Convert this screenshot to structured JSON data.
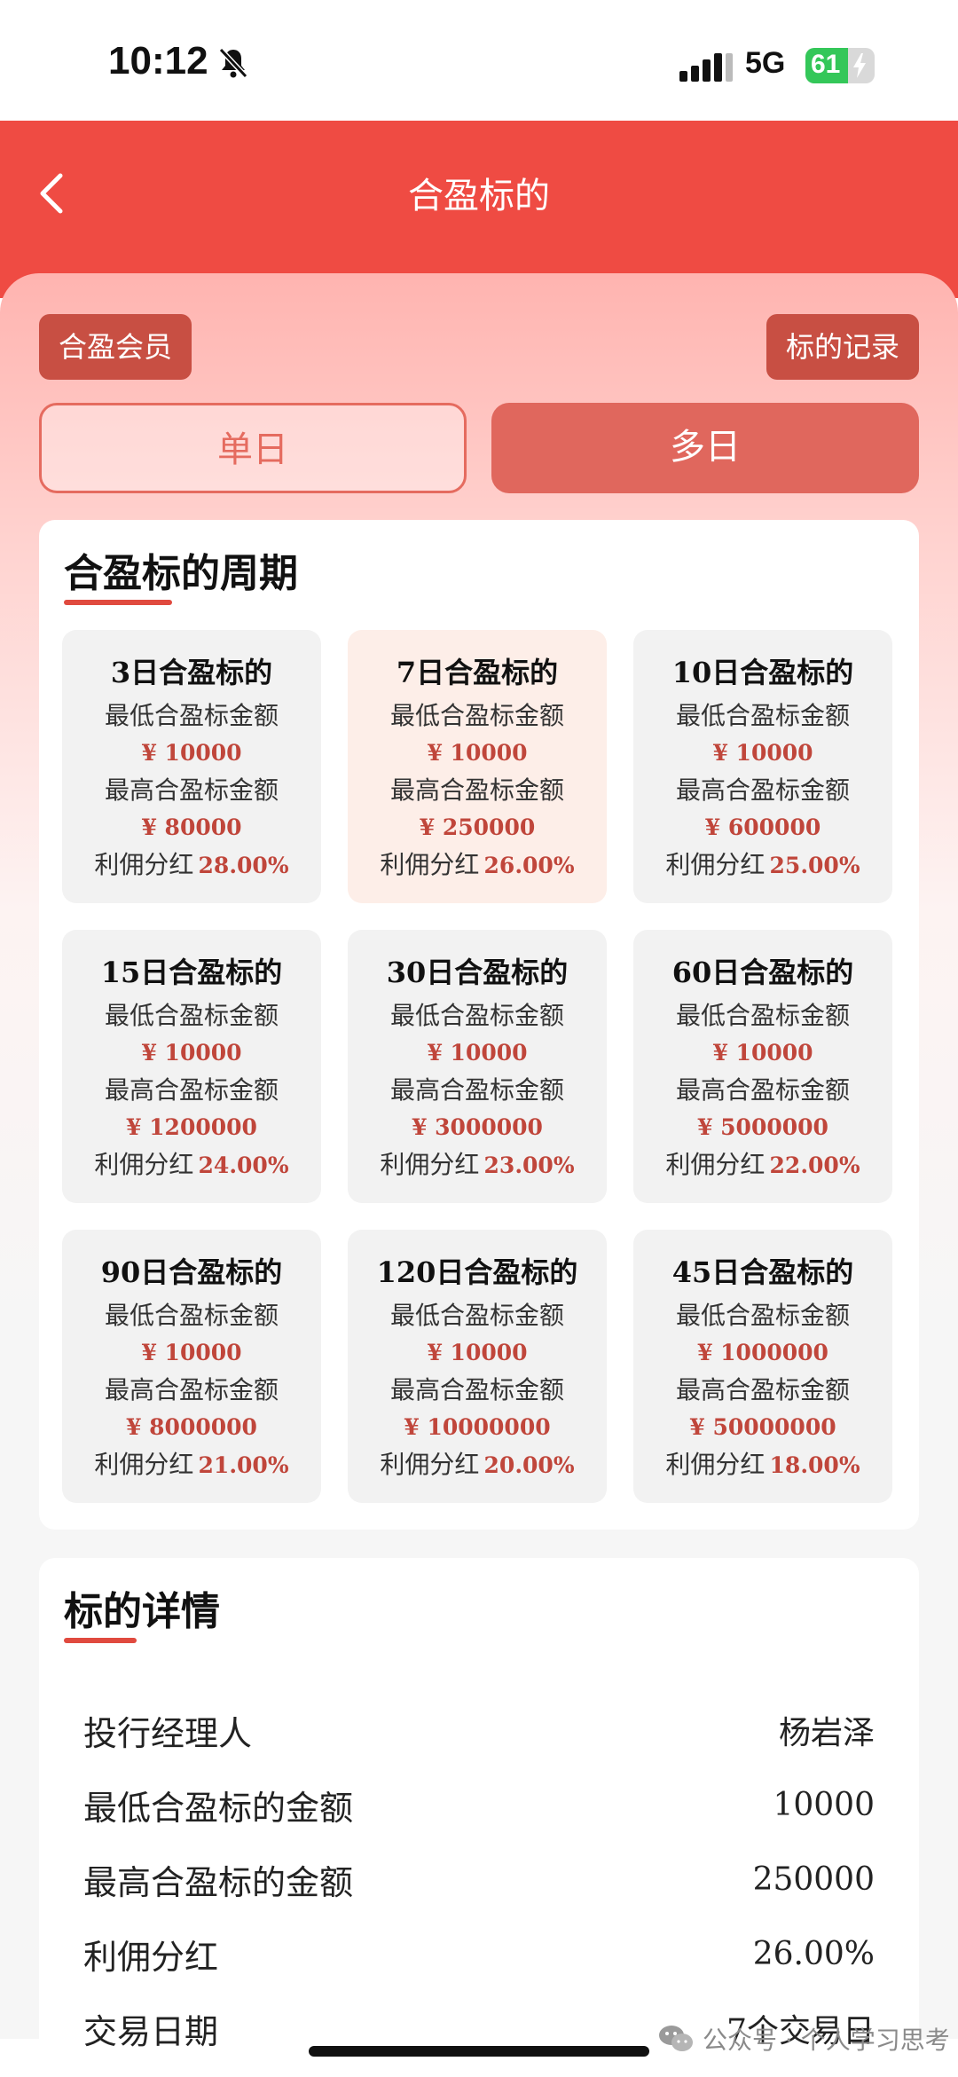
{
  "status_bar": {
    "time": "10:12",
    "network": "5G",
    "battery": "61",
    "battery_level": 0.61
  },
  "header": {
    "title": "合盈标的"
  },
  "top_buttons": {
    "member": "合盈会员",
    "records": "标的记录"
  },
  "segment": {
    "single_day": "单日",
    "multi_day": "多日",
    "selected": "多日"
  },
  "period_section": {
    "title": "合盈标的周期",
    "min_label": "最低合盈标金额",
    "max_label": "最高合盈标金额",
    "rate_label": "利佣分红",
    "plans": [
      {
        "name": "3日合盈标的",
        "min": "¥ 10000",
        "max": "¥ 80000",
        "rate": "28.00%",
        "selected": false
      },
      {
        "name": "7日合盈标的",
        "min": "¥ 10000",
        "max": "¥ 250000",
        "rate": "26.00%",
        "selected": true
      },
      {
        "name": "10日合盈标的",
        "min": "¥ 10000",
        "max": "¥ 600000",
        "rate": "25.00%",
        "selected": false
      },
      {
        "name": "15日合盈标的",
        "min": "¥ 10000",
        "max": "¥ 1200000",
        "rate": "24.00%",
        "selected": false
      },
      {
        "name": "30日合盈标的",
        "min": "¥ 10000",
        "max": "¥ 3000000",
        "rate": "23.00%",
        "selected": false
      },
      {
        "name": "60日合盈标的",
        "min": "¥ 10000",
        "max": "¥ 5000000",
        "rate": "22.00%",
        "selected": false
      },
      {
        "name": "90日合盈标的",
        "min": "¥ 10000",
        "max": "¥ 8000000",
        "rate": "21.00%",
        "selected": false
      },
      {
        "name": "120日合盈标的",
        "min": "¥ 10000",
        "max": "¥ 10000000",
        "rate": "20.00%",
        "selected": false
      },
      {
        "name": "45日合盈标的",
        "min": "¥ 1000000",
        "max": "¥ 50000000",
        "rate": "18.00%",
        "selected": false
      }
    ]
  },
  "detail_section": {
    "title": "标的详情",
    "rows": [
      {
        "label": "投行经理人",
        "value": "杨岩泽"
      },
      {
        "label": "最低合盈标的金额",
        "value": "10000"
      },
      {
        "label": "最高合盈标的金额",
        "value": "250000"
      },
      {
        "label": "利佣分红",
        "value": "26.00%"
      },
      {
        "label": "交易日期",
        "value": "7个交易日"
      }
    ]
  },
  "watermark": {
    "text": "公众号 · 个人学习思考"
  },
  "colors": {
    "header_red": "#ef4b43",
    "accent_red": "#c0463b",
    "button_brown_red": "#c84f43",
    "selected_segment": "#e0675d"
  }
}
